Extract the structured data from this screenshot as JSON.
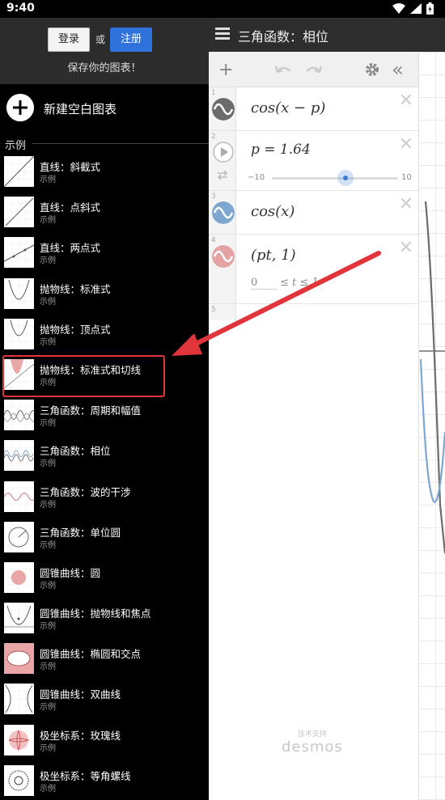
{
  "status": {
    "time": "9:40"
  },
  "app": {
    "title": "三角函数：相位"
  },
  "drawer": {
    "login_label": "登录",
    "or_label": "或",
    "signup_label": "注册",
    "save_prompt": "保存你的图表！",
    "new_graph_label": "新建空白图表",
    "section_label": "示例",
    "examples": [
      {
        "title": "直线：斜截式",
        "sub": "示例"
      },
      {
        "title": "直线：点斜式",
        "sub": "示例"
      },
      {
        "title": "直线：两点式",
        "sub": "示例"
      },
      {
        "title": "抛物线：标准式",
        "sub": "示例"
      },
      {
        "title": "抛物线：顶点式",
        "sub": "示例"
      },
      {
        "title": "抛物线：标准式和切线",
        "sub": "示例"
      },
      {
        "title": "三角函数：周期和幅值",
        "sub": "示例"
      },
      {
        "title": "三角函数：相位",
        "sub": "示例"
      },
      {
        "title": "三角函数：波的干涉",
        "sub": "示例"
      },
      {
        "title": "三角函数：单位圆",
        "sub": "示例"
      },
      {
        "title": "圆锥曲线：圆",
        "sub": "示例"
      },
      {
        "title": "圆锥曲线：抛物线和焦点",
        "sub": "示例"
      },
      {
        "title": "圆锥曲线：椭圆和交点",
        "sub": "示例"
      },
      {
        "title": "圆锥曲线：双曲线",
        "sub": "示例"
      },
      {
        "title": "极坐标系：玫瑰线",
        "sub": "示例"
      },
      {
        "title": "极坐标系：等角螺线",
        "sub": "示例"
      }
    ]
  },
  "expressions": [
    {
      "num": "1",
      "latex": "cos(x − p)",
      "color": "#6b6b6b"
    },
    {
      "num": "2",
      "latex": "p = 1.64",
      "slider_min": "−10",
      "slider_max": "10",
      "slider_value": 0.582
    },
    {
      "num": "3",
      "latex": "cos(x)",
      "color": "#7ea6cf"
    },
    {
      "num": "4",
      "latex": "(pt, 1)",
      "range_min": "0",
      "range_text": "≤ t ≤ 1",
      "color": "#e3a3a3"
    },
    {
      "num": "5"
    }
  ],
  "footer": {
    "powered_by": "技术支持",
    "brand": "desmos"
  },
  "colors": {
    "accent_red": "#e0353b",
    "signup_blue": "#2f72dc"
  }
}
